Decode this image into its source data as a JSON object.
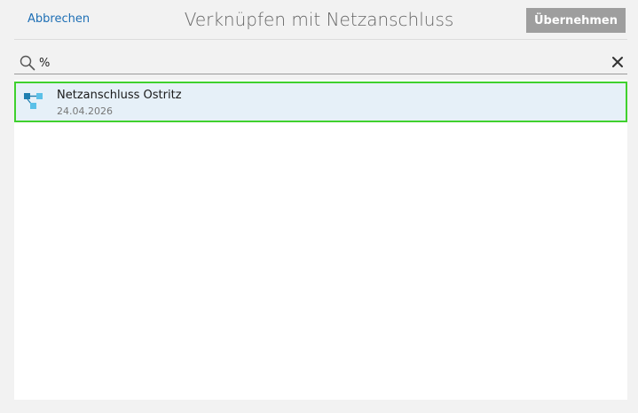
{
  "header": {
    "cancel_label": "Abbrechen",
    "title": "Verknüpfen mit Netzanschluss",
    "apply_label": "Übernehmen"
  },
  "search": {
    "value": "%",
    "icon": "search-icon",
    "clear_icon": "close-icon"
  },
  "results": [
    {
      "title": "Netzanschluss Ostritz",
      "date": "24.04.2026",
      "icon": "network-connection-icon",
      "selected": true
    }
  ],
  "colors": {
    "accent_link": "#1e6fb5",
    "apply_button_disabled": "#9e9e9e",
    "selection_border": "#3fd12e",
    "selection_background": "#e6f0f8",
    "icon_dark": "#1f7fb0",
    "icon_light": "#5bc0e8"
  }
}
